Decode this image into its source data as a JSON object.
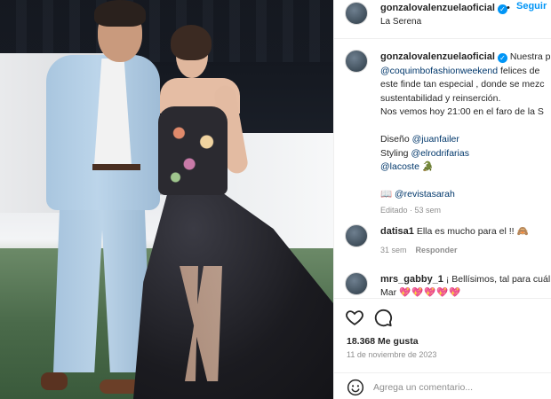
{
  "post": {
    "author": "gonzalovalenzuelaoficial",
    "verified": true,
    "follow_label": "Seguir",
    "separator": "•",
    "location": "La Serena",
    "photo_icon": "photo"
  },
  "caption": {
    "line1_username": "gonzalovalenzuelaoficial",
    "line1_text": " Nuestra p",
    "line2_handle": "@coquimbofashionweekend",
    "line2_text": " felices de",
    "line3": "este finde tan especial , donde se mezc",
    "line4": "sustentabilidad y reinserción.",
    "line5": "Nos vemos hoy 21:00 en el faro de la S",
    "design_label": "Diseño ",
    "design_handle": "@juanfailer",
    "styling_label": "Styling ",
    "styling_handle": "@elrodrifarias",
    "brand_handle": "@lacoste",
    "brand_emoji": "🐊",
    "mag_emoji": "📖",
    "mag_handle": "@revistasarah",
    "edited": "Editado · 53 sem"
  },
  "comments": [
    {
      "username": "datisa1",
      "text": " Ella es mucho para el !! 🙈",
      "time": "31 sem",
      "reply_label": "Responder"
    },
    {
      "username": "mrs_gabby_1",
      "text": " ¡ Bellísimos, tal para cuál",
      "line2": "Mar ",
      "hearts": "💖💖💖💖💖"
    }
  ],
  "actions": {
    "like_icon": "heart-outline",
    "comment_icon": "comment-bubble",
    "likes": "18.368 Me gusta",
    "date": "11 de noviembre de 2023"
  },
  "add_comment": {
    "placeholder": "Agrega un comentario...",
    "emoji_icon": "smiley"
  }
}
